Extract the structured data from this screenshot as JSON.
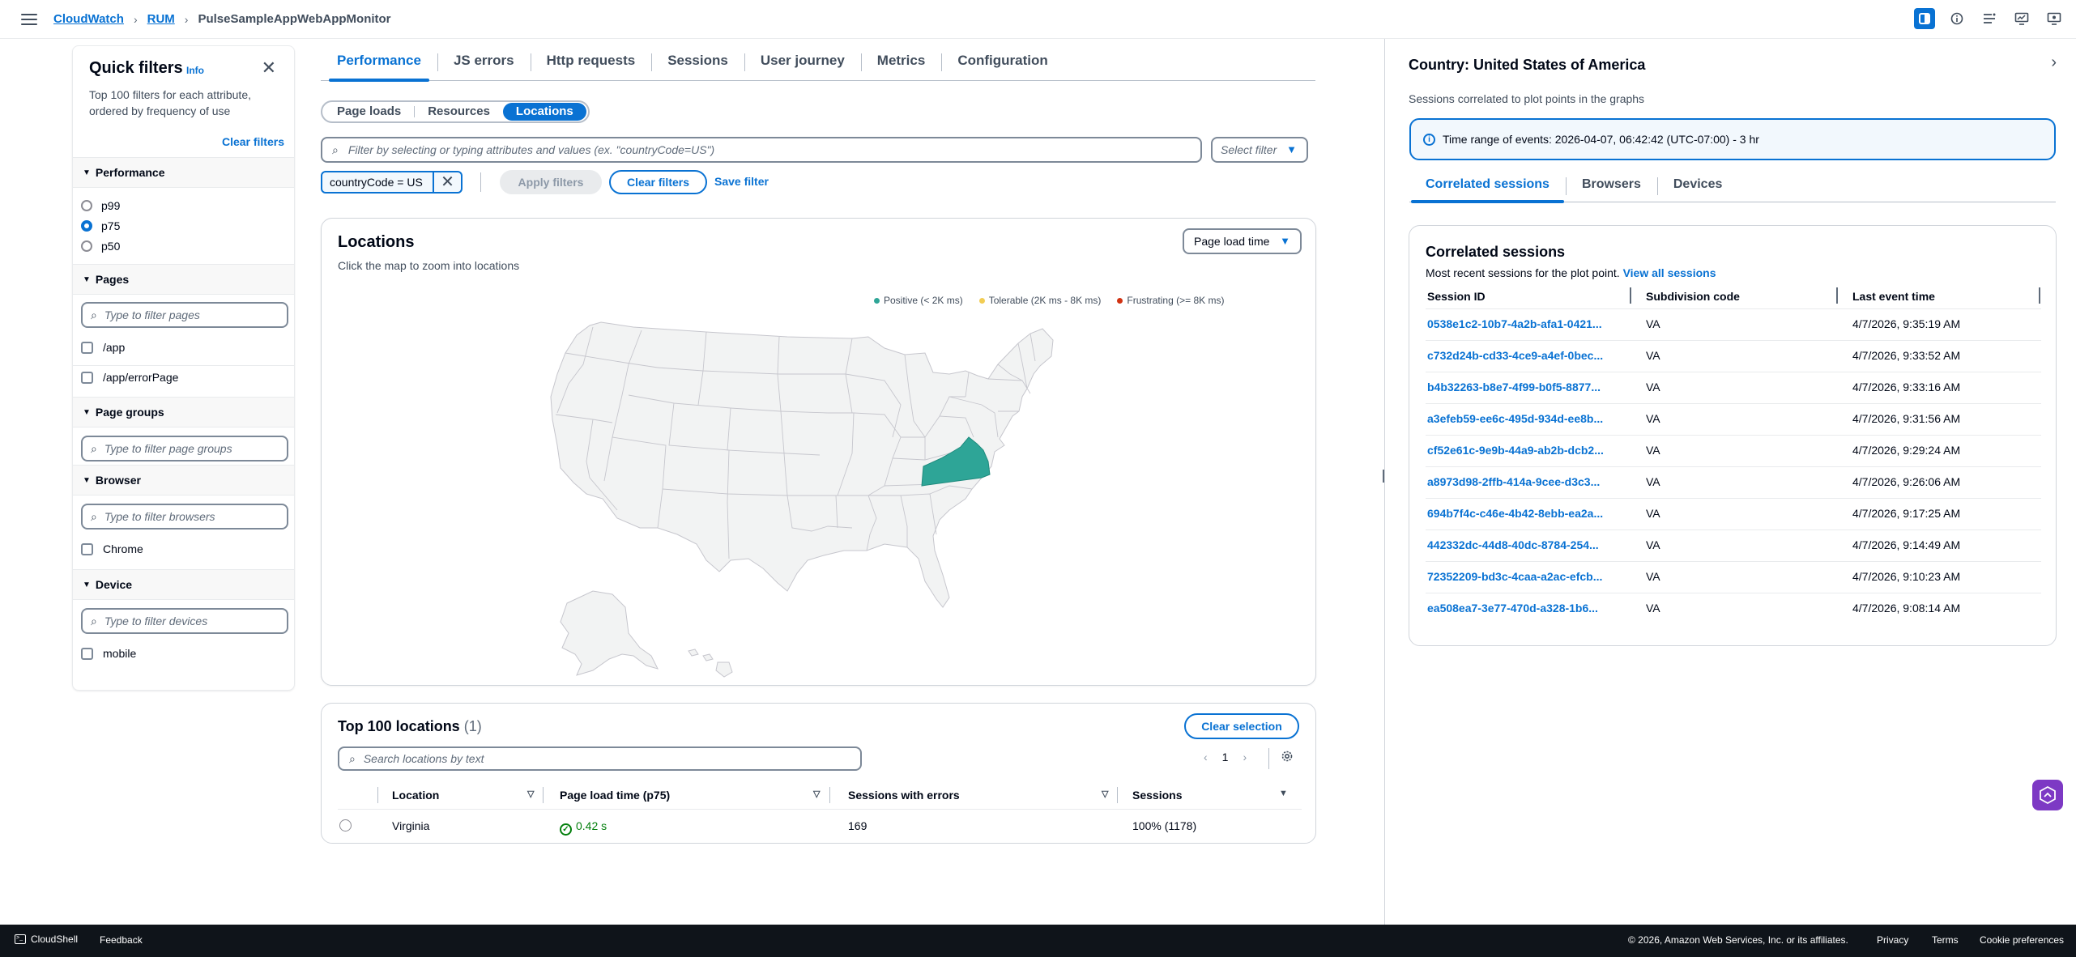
{
  "breadcrumb": {
    "items": [
      "CloudWatch",
      "RUM"
    ],
    "current": "PulseSampleAppWebAppMonitor"
  },
  "quick_filters": {
    "title": "Quick filters",
    "info": "Info",
    "description": "Top 100 filters for each attribute, ordered by frequency of use",
    "clear": "Clear filters",
    "performance": {
      "label": "Performance",
      "options": [
        "p99",
        "p75",
        "p50"
      ],
      "selected": "p75"
    },
    "pages": {
      "label": "Pages",
      "placeholder": "Type to filter pages",
      "items": [
        "/app",
        "/app/errorPage"
      ]
    },
    "page_groups": {
      "label": "Page groups",
      "placeholder": "Type to filter page groups"
    },
    "browser": {
      "label": "Browser",
      "placeholder": "Type to filter browsers",
      "items": [
        "Chrome"
      ]
    },
    "device": {
      "label": "Device",
      "placeholder": "Type to filter devices",
      "items": [
        "mobile"
      ]
    }
  },
  "tabs": [
    "Performance",
    "JS errors",
    "Http requests",
    "Sessions",
    "User journey",
    "Metrics",
    "Configuration"
  ],
  "segments": [
    "Page loads",
    "Resources",
    "Locations"
  ],
  "filter": {
    "placeholder": "Filter by selecting or typing attributes and values (ex. \"countryCode=US\")",
    "select_placeholder": "Select filter",
    "token": "countryCode = US",
    "apply": "Apply filters",
    "clear": "Clear filters",
    "save": "Save filter"
  },
  "map": {
    "title": "Locations",
    "description": "Click the map to zoom into locations",
    "metric": "Page load time",
    "legend": [
      {
        "label": "Positive (< 2K ms)",
        "color": "#2ea597"
      },
      {
        "label": "Tolerable (2K ms - 8K ms)",
        "color": "#f2cd54"
      },
      {
        "label": "Frustrating (>= 8K ms)",
        "color": "#d13212"
      }
    ],
    "highlighted_state": "Virginia",
    "highlight_color": "#2ea597"
  },
  "locations": {
    "title": "Top 100 locations",
    "count": "(1)",
    "clear_selection": "Clear selection",
    "search_placeholder": "Search locations by text",
    "page": "1",
    "columns": [
      "Location",
      "Page load time (p75)",
      "Sessions with errors",
      "Sessions"
    ],
    "rows": [
      {
        "location": "Virginia",
        "load_time": "0.42 s",
        "errors": "169",
        "sessions": "100% (1178)"
      }
    ]
  },
  "drawer": {
    "title": "Country: United States of America",
    "subtitle": "Sessions correlated to plot points in the graphs",
    "time_range": "Time range of events: 2026-04-07, 06:42:42 (UTC-07:00) - 3 hr",
    "tabs": [
      "Correlated sessions",
      "Browsers",
      "Devices"
    ],
    "card_title": "Correlated sessions",
    "card_desc": "Most recent sessions for the plot point.",
    "view_all": "View all sessions",
    "columns": [
      "Session ID",
      "Subdivision code",
      "Last event time"
    ],
    "sessions": [
      {
        "id": "0538e1c2-10b7-4a2b-afa1-0421...",
        "code": "VA",
        "time": "4/7/2026, 9:35:19 AM"
      },
      {
        "id": "c732d24b-cd33-4ce9-a4ef-0bec...",
        "code": "VA",
        "time": "4/7/2026, 9:33:52 AM"
      },
      {
        "id": "b4b32263-b8e7-4f99-b0f5-8877...",
        "code": "VA",
        "time": "4/7/2026, 9:33:16 AM"
      },
      {
        "id": "a3efeb59-ee6c-495d-934d-ee8b...",
        "code": "VA",
        "time": "4/7/2026, 9:31:56 AM"
      },
      {
        "id": "cf52e61c-9e9b-44a9-ab2b-dcb2...",
        "code": "VA",
        "time": "4/7/2026, 9:29:24 AM"
      },
      {
        "id": "a8973d98-2ffb-414a-9cee-d3c3...",
        "code": "VA",
        "time": "4/7/2026, 9:26:06 AM"
      },
      {
        "id": "694b7f4c-c46e-4b42-8ebb-ea2a...",
        "code": "VA",
        "time": "4/7/2026, 9:17:25 AM"
      },
      {
        "id": "442332dc-44d8-40dc-8784-254...",
        "code": "VA",
        "time": "4/7/2026, 9:14:49 AM"
      },
      {
        "id": "72352209-bd3c-4caa-a2ac-efcb...",
        "code": "VA",
        "time": "4/7/2026, 9:10:23 AM"
      },
      {
        "id": "ea508ea7-3e77-470d-a328-1b6...",
        "code": "VA",
        "time": "4/7/2026, 9:08:14 AM"
      }
    ]
  },
  "footer": {
    "cloudshell": "CloudShell",
    "feedback": "Feedback",
    "copyright": "© 2026, Amazon Web Services, Inc. or its affiliates.",
    "privacy": "Privacy",
    "terms": "Terms",
    "cookie": "Cookie preferences"
  },
  "colors": {
    "accent": "#0972d3",
    "footer_bg": "#0f141a",
    "success": "#037f0c",
    "help": "#7d39c4"
  }
}
